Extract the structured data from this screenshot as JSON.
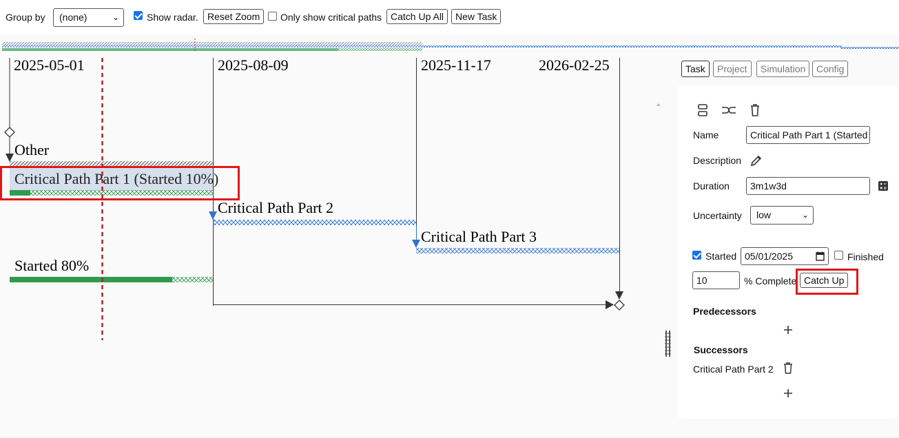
{
  "toolbar": {
    "group_by_label": "Group by",
    "group_by_value": "(none)",
    "show_radar_label": "Show radar.",
    "show_radar_checked": true,
    "reset_zoom_label": "Reset Zoom",
    "critical_only_label": "Only show critical paths",
    "critical_only_checked": false,
    "catch_up_all_label": "Catch Up All",
    "new_task_label": "New Task"
  },
  "chart": {
    "dates": [
      "2025-05-01",
      "2025-08-09",
      "2025-11-17",
      "2026-02-25"
    ],
    "tasks": [
      {
        "name": "Other",
        "role": "group"
      },
      {
        "name": "Critical Path Part 1 (Started 10%)",
        "percent": 10,
        "selected": true
      },
      {
        "name": "Critical Path Part 2",
        "percent": 0
      },
      {
        "name": "Critical Path Part 3",
        "percent": 0
      },
      {
        "name": "Started 80%",
        "percent": 80
      }
    ]
  },
  "tabs": [
    {
      "label": "Task",
      "active": true
    },
    {
      "label": "Project",
      "active": false
    },
    {
      "label": "Simulation",
      "active": false
    },
    {
      "label": "Config",
      "active": false
    }
  ],
  "task_panel": {
    "icons": [
      "split-icon",
      "merge-icon",
      "trash-icon"
    ],
    "name_label": "Name",
    "name_value": "Critical Path Part 1 (Started",
    "description_label": "Description",
    "duration_label": "Duration",
    "duration_value": "3m1w3d",
    "uncertainty_label": "Uncertainty",
    "uncertainty_value": "low",
    "started_label": "Started",
    "started_checked": true,
    "started_date": "05/01/2025",
    "finished_label": "Finished",
    "finished_checked": false,
    "percent_value": "10",
    "percent_label": "% Complete",
    "catch_up_label": "Catch Up",
    "predecessors_heading": "Predecessors",
    "successors_heading": "Successors",
    "successors": [
      "Critical Path Part 2"
    ]
  },
  "colors": {
    "critical_blue": "#2f74d0",
    "progress_green": "#2e9b4e",
    "today_line": "#b22222",
    "highlight_red": "#e01818"
  }
}
